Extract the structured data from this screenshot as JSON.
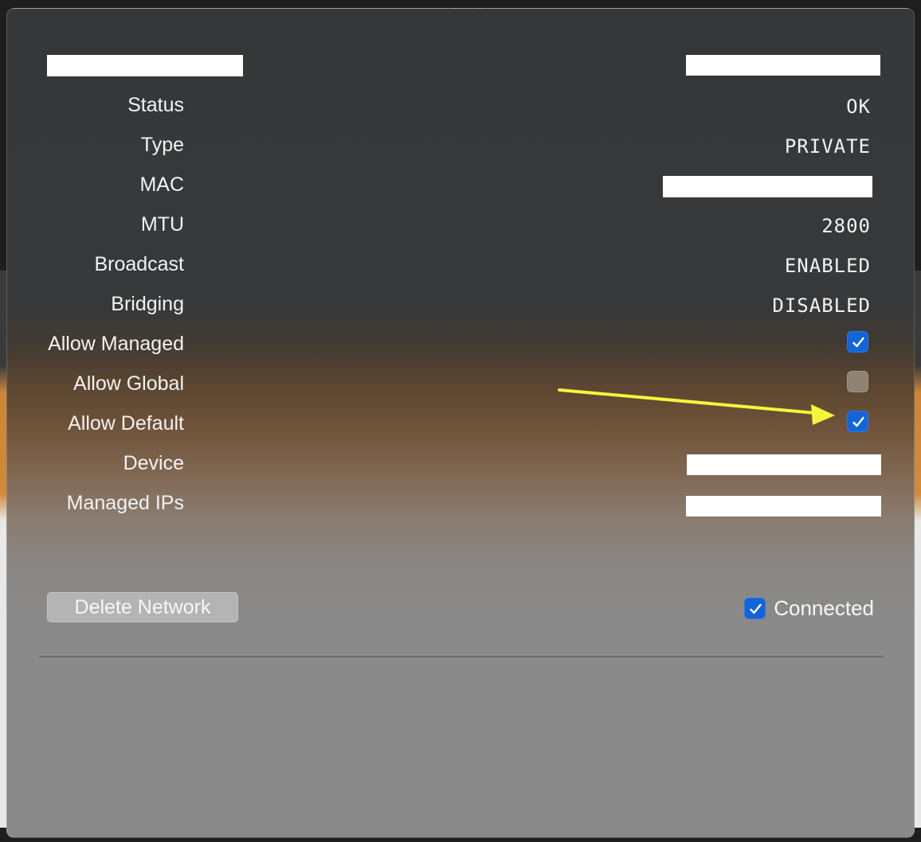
{
  "popover": {
    "rows": [
      {
        "label": "Status",
        "value": "OK"
      },
      {
        "label": "Type",
        "value": "PRIVATE"
      },
      {
        "label": "MAC",
        "value": ""
      },
      {
        "label": "MTU",
        "value": "2800"
      },
      {
        "label": "Broadcast",
        "value": "ENABLED"
      },
      {
        "label": "Bridging",
        "value": "DISABLED"
      },
      {
        "label": "Allow Managed",
        "checked": true
      },
      {
        "label": "Allow Global",
        "checked": false
      },
      {
        "label": "Allow Default",
        "checked": true
      },
      {
        "label": "Device",
        "value": ""
      },
      {
        "label": "Managed IPs",
        "value": ""
      }
    ],
    "delete_button_label": "Delete Network",
    "connected_label": "Connected",
    "connected_checked": true
  },
  "colors": {
    "checkbox_on": "#1464d8",
    "checkbox_off": "#8e8273",
    "annotation_arrow": "#f5f53c"
  },
  "icons": {
    "check": "checkmark-icon",
    "annotation": "yellow-arrow-annotation"
  }
}
